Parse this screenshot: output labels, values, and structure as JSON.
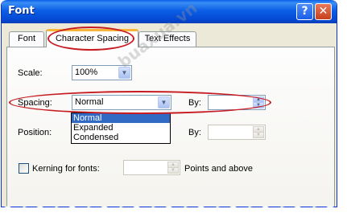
{
  "window": {
    "title": "Font",
    "help_glyph": "?",
    "close_glyph": "✕"
  },
  "tabs": [
    {
      "label": "Font"
    },
    {
      "label": "Character Spacing",
      "active": true
    },
    {
      "label": "Text Effects"
    }
  ],
  "scale": {
    "label": "Scale:",
    "value": "100%"
  },
  "spacing": {
    "label": "Spacing:",
    "value": "Normal",
    "by_label": "By:",
    "options": [
      "Normal",
      "Expanded",
      "Condensed"
    ],
    "selected_option": "Normal"
  },
  "position": {
    "label": "Position:",
    "by_label": "By:"
  },
  "kerning": {
    "label": "Kerning for fonts:",
    "checked": false,
    "suffix": "Points and above"
  },
  "watermark": "buaxua.vn",
  "colors": {
    "title_bar": "#0a5ee8",
    "highlight_oval": "#c71c22",
    "selection": "#316ac5"
  },
  "icons": {
    "dropdown_arrow": "▼",
    "spin_up": "▲",
    "spin_down": "▼"
  }
}
